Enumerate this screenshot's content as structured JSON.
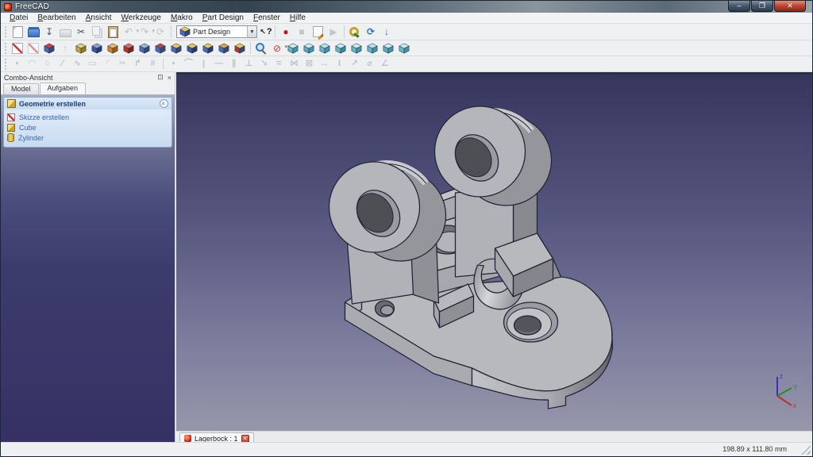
{
  "window": {
    "title": "FreeCAD",
    "controls": {
      "minimize": "–",
      "maximize": "❐",
      "close": "✕"
    }
  },
  "menubar": {
    "items": [
      "Datei",
      "Bearbeiten",
      "Ansicht",
      "Werkzeuge",
      "Makro",
      "Part Design",
      "Fenster",
      "Hilfe"
    ]
  },
  "toolbars": {
    "standard": [
      {
        "name": "new-file",
        "kind": "css"
      },
      {
        "name": "open-file",
        "kind": "css"
      },
      {
        "name": "save-file",
        "glyph": "↧",
        "color": "#4a5560"
      },
      {
        "name": "print",
        "kind": "css",
        "disabled": true
      },
      {
        "name": "cut",
        "glyph": "✂",
        "color": "#44506a"
      },
      {
        "name": "copy",
        "kind": "css",
        "disabled": true
      },
      {
        "name": "paste",
        "kind": "css"
      },
      {
        "name": "undo",
        "glyph": "↶",
        "color": "#8892a0",
        "disabled": true,
        "dropdown": true
      },
      {
        "name": "redo",
        "glyph": "↷",
        "color": "#8892a0",
        "disabled": true,
        "dropdown": true
      },
      {
        "name": "refresh",
        "glyph": "⟳",
        "color": "#98a0ac",
        "disabled": true
      }
    ],
    "workbench_selector": {
      "value": "Part Design"
    },
    "macro": [
      {
        "name": "macro-record",
        "glyph": "●",
        "color": "#cc1620"
      },
      {
        "name": "macro-stop",
        "glyph": "■",
        "color": "#9aa0a8",
        "disabled": true
      },
      {
        "name": "macro-edit",
        "kind": "css"
      },
      {
        "name": "macro-play",
        "glyph": "▶",
        "color": "#9aa0a8",
        "disabled": true
      }
    ],
    "web": [
      {
        "name": "key",
        "kind": "css"
      },
      {
        "name": "sync",
        "glyph": "⟳",
        "color": "#2b6fd4"
      },
      {
        "name": "download",
        "glyph": "↓",
        "color": "#2b6fd4"
      }
    ],
    "partdesign": [
      {
        "name": "create-sketch",
        "kind": "css"
      },
      {
        "name": "view-sketch",
        "kind": "css",
        "disabled": true
      },
      {
        "name": "map-sketch",
        "kind": "cube",
        "colors": [
          "#c84040",
          "#4a6ab8",
          "#32497e"
        ]
      },
      {
        "name": "leave-sketch",
        "glyph": "↑",
        "color": "#9aa2ae",
        "disabled": true
      },
      {
        "name": "pad",
        "kind": "cube",
        "colors": [
          "#ead27e",
          "#c8a23e",
          "#97781f"
        ]
      },
      {
        "name": "pocket",
        "kind": "cube",
        "colors": [
          "#8fa3d0",
          "#3a57a5",
          "#243a74"
        ]
      },
      {
        "name": "revolution",
        "kind": "cube",
        "colors": [
          "#f2b863",
          "#d3821f",
          "#9c5d12"
        ]
      },
      {
        "name": "groove",
        "kind": "cube",
        "colors": [
          "#d97263",
          "#b03a2a",
          "#7c241a"
        ]
      },
      {
        "name": "fillet",
        "kind": "cube",
        "colors": [
          "#9db4dd",
          "#4a6ab8",
          "#32497e"
        ]
      },
      {
        "name": "chamfer",
        "kind": "cube",
        "colors": [
          "#b84848",
          "#4a6ab8",
          "#32497e"
        ]
      },
      {
        "name": "mirrored",
        "kind": "cube",
        "colors": [
          "#e8c85c",
          "#4a6ab8",
          "#32497e"
        ]
      },
      {
        "name": "linear-pattern",
        "kind": "cube",
        "colors": [
          "#e8c85c",
          "#3a57a5",
          "#243a74"
        ]
      },
      {
        "name": "polar-pattern",
        "kind": "cube",
        "colors": [
          "#e8c85c",
          "#4a6ab8",
          "#243a74"
        ]
      },
      {
        "name": "scaled",
        "kind": "cube",
        "colors": [
          "#d9a44a",
          "#4a6ab8",
          "#32497e"
        ]
      },
      {
        "name": "multi-transform",
        "kind": "cube",
        "colors": [
          "#e8c85c",
          "#b03a2a",
          "#32497e"
        ]
      }
    ],
    "view": [
      {
        "name": "fit-all",
        "kind": "css"
      },
      {
        "name": "draw-style",
        "glyph": "⊘",
        "color": "#c63333",
        "dropdown": true
      },
      {
        "name": "view-axonometric",
        "kind": "cube",
        "colors": [
          "#cfeef2",
          "#62b6c6",
          "#3f93ab"
        ]
      },
      {
        "name": "view-front",
        "kind": "cube",
        "colors": [
          "#cfeef2",
          "#58aabc",
          "#3f93ab"
        ]
      },
      {
        "name": "view-top",
        "kind": "cube",
        "colors": [
          "#9adoesnt",
          "#62b6c6",
          "#3f93ab"
        ],
        "colors_fix": [
          "#bde6ec",
          "#62b6c6",
          "#3f93ab"
        ]
      },
      {
        "name": "view-right",
        "kind": "cube",
        "colors": [
          "#cfeef2",
          "#62b6c6",
          "#35889e"
        ]
      },
      {
        "name": "view-rear",
        "kind": "cube",
        "colors": [
          "#cfeef2",
          "#62b6c6",
          "#3f93ab"
        ]
      },
      {
        "name": "view-bottom",
        "kind": "cube",
        "colors": [
          "#bde6ec",
          "#62b6c6",
          "#3f93ab"
        ]
      },
      {
        "name": "view-left",
        "kind": "cube",
        "colors": [
          "#cfeef2",
          "#58aabc",
          "#3f93ab"
        ]
      },
      {
        "name": "measure-distance",
        "kind": "cube",
        "colors": [
          "#cfeef2",
          "#62b6c6",
          "#3f93ab"
        ]
      }
    ],
    "sketcher_geometry": [
      {
        "name": "sketch-point",
        "glyph": "•",
        "disabled": true
      },
      {
        "name": "sketch-arc",
        "glyph": "◠",
        "disabled": true
      },
      {
        "name": "sketch-circle",
        "glyph": "○",
        "disabled": true
      },
      {
        "name": "sketch-line",
        "glyph": "∕",
        "disabled": true
      },
      {
        "name": "sketch-polyline",
        "glyph": "∿",
        "disabled": true
      },
      {
        "name": "sketch-rectangle",
        "glyph": "▭",
        "disabled": true
      },
      {
        "name": "sketch-fillet",
        "glyph": "◜",
        "disabled": true
      },
      {
        "name": "sketch-trim",
        "glyph": "✂",
        "disabled": true
      },
      {
        "name": "sketch-external",
        "glyph": "↱",
        "disabled": true
      },
      {
        "name": "sketch-construction",
        "glyph": "#",
        "disabled": true
      }
    ],
    "sketcher_constraints": [
      {
        "name": "constraint-coincident",
        "glyph": "•",
        "disabled": true
      },
      {
        "name": "constraint-point-on-object",
        "glyph": "⌒",
        "disabled": true
      },
      {
        "name": "constraint-vertical",
        "glyph": "|",
        "disabled": true
      },
      {
        "name": "constraint-horizontal",
        "glyph": "—",
        "disabled": true
      },
      {
        "name": "constraint-parallel",
        "glyph": "∥",
        "disabled": true
      },
      {
        "name": "constraint-perpendicular",
        "glyph": "⊥",
        "disabled": true
      },
      {
        "name": "constraint-tangent",
        "glyph": "↘",
        "disabled": true
      },
      {
        "name": "constraint-equal",
        "glyph": "=",
        "disabled": true
      },
      {
        "name": "constraint-symmetric",
        "glyph": "⋈",
        "disabled": true
      },
      {
        "name": "constraint-lock",
        "glyph": "⊠",
        "disabled": true
      },
      {
        "name": "constraint-horizontal-distance",
        "glyph": "↔",
        "disabled": true
      },
      {
        "name": "constraint-vertical-distance",
        "glyph": "I",
        "disabled": true
      },
      {
        "name": "constraint-length",
        "glyph": "↗",
        "disabled": true
      },
      {
        "name": "constraint-radius",
        "glyph": "⌀",
        "disabled": true
      },
      {
        "name": "constraint-angle",
        "glyph": "∠",
        "disabled": true
      }
    ]
  },
  "combo_view": {
    "title": "Combo-Ansicht",
    "tabs": [
      "Model",
      "Aufgaben"
    ],
    "active_tab": "Aufgaben",
    "task_panel": {
      "header": "Geometrie erstellen",
      "items": [
        {
          "label": "Skizze erstellen",
          "icon": "sketch"
        },
        {
          "label": "Cube",
          "icon": "cube"
        },
        {
          "label": "Zylinder",
          "icon": "cylinder"
        }
      ]
    }
  },
  "viewport": {
    "bg_top": "#36365c",
    "bg_bottom": "#9697ab",
    "axis": {
      "x": {
        "label": "x",
        "color": "#b83030"
      },
      "y": {
        "label": "Y",
        "color": "#2a8a2a"
      },
      "z": {
        "label": "z",
        "color": "#3434bb"
      }
    }
  },
  "document_tab": {
    "label": "Lagerbock : 1"
  },
  "statusbar": {
    "dimensions": "198.89 x 111.80 mm"
  }
}
